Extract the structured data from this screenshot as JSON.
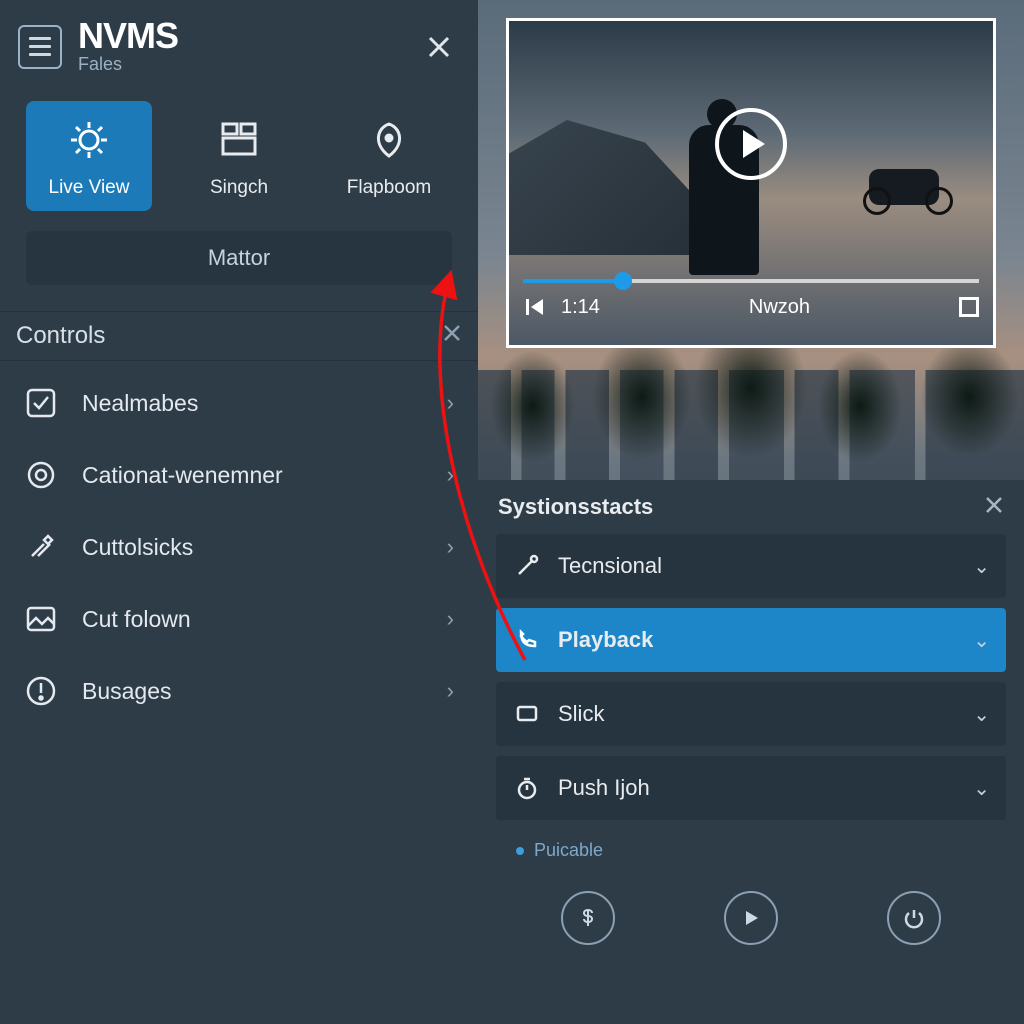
{
  "brand": {
    "name": "NVMS",
    "sub": "Fales"
  },
  "tiles": {
    "live": {
      "label": "Live View",
      "icon": "gear"
    },
    "singch": {
      "label": "Singch",
      "icon": "grid"
    },
    "flapboom": {
      "label": "Flapboom",
      "icon": "leaf"
    }
  },
  "mattor_label": "Mattor",
  "controls": {
    "heading": "Controls",
    "items": [
      {
        "label": "Nealmabes",
        "icon": "check-square"
      },
      {
        "label": "Cationat-wenemner",
        "icon": "target"
      },
      {
        "label": "Cuttolsicks",
        "icon": "tools"
      },
      {
        "label": "Cut folown",
        "icon": "image"
      },
      {
        "label": "Busages",
        "icon": "alert"
      }
    ]
  },
  "video": {
    "time": "1:14",
    "center_label": "Nwzoh"
  },
  "sys": {
    "heading": "Systionsstacts",
    "items": [
      {
        "label": "Tecnsional",
        "icon": "wand"
      },
      {
        "label": "Playback",
        "icon": "phone"
      },
      {
        "label": "Slick",
        "icon": "monitor"
      },
      {
        "label": "Push Ijoh",
        "icon": "timer"
      }
    ],
    "sub_label": "Puicable"
  },
  "colors": {
    "accent": "#1d86c9"
  }
}
